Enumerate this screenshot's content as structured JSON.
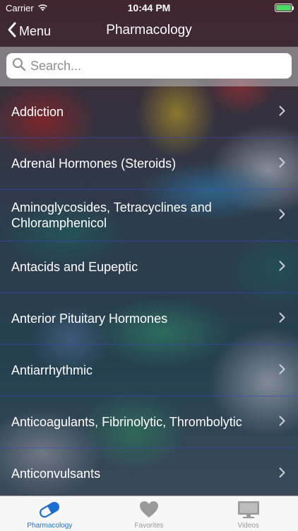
{
  "status": {
    "carrier": "Carrier",
    "time": "10:44 PM",
    "battery_level": 1.0
  },
  "nav": {
    "back_label": "Menu",
    "title": "Pharmacology"
  },
  "search": {
    "placeholder": "Search..."
  },
  "colors": {
    "accent": "#1a6fd6",
    "separator": "#3c46c8",
    "battery": "#4cd964"
  },
  "list": {
    "items": [
      {
        "label": "Addiction"
      },
      {
        "label": "Adrenal Hormones (Steroids)"
      },
      {
        "label": "Aminoglycosides, Tetracyclines and Chloramphenicol"
      },
      {
        "label": "Antacids and Eupeptic"
      },
      {
        "label": "Anterior Pituitary Hormones"
      },
      {
        "label": "Antiarrhythmic"
      },
      {
        "label": "Anticoagulants, Fibrinolytic, Thrombolytic"
      },
      {
        "label": "Anticonvulsants"
      }
    ]
  },
  "tabs": [
    {
      "label": "Pharmacology",
      "icon": "capsule-icon",
      "active": true
    },
    {
      "label": "Favorites",
      "icon": "heart-icon",
      "active": false
    },
    {
      "label": "Videos",
      "icon": "tv-icon",
      "active": false
    }
  ]
}
